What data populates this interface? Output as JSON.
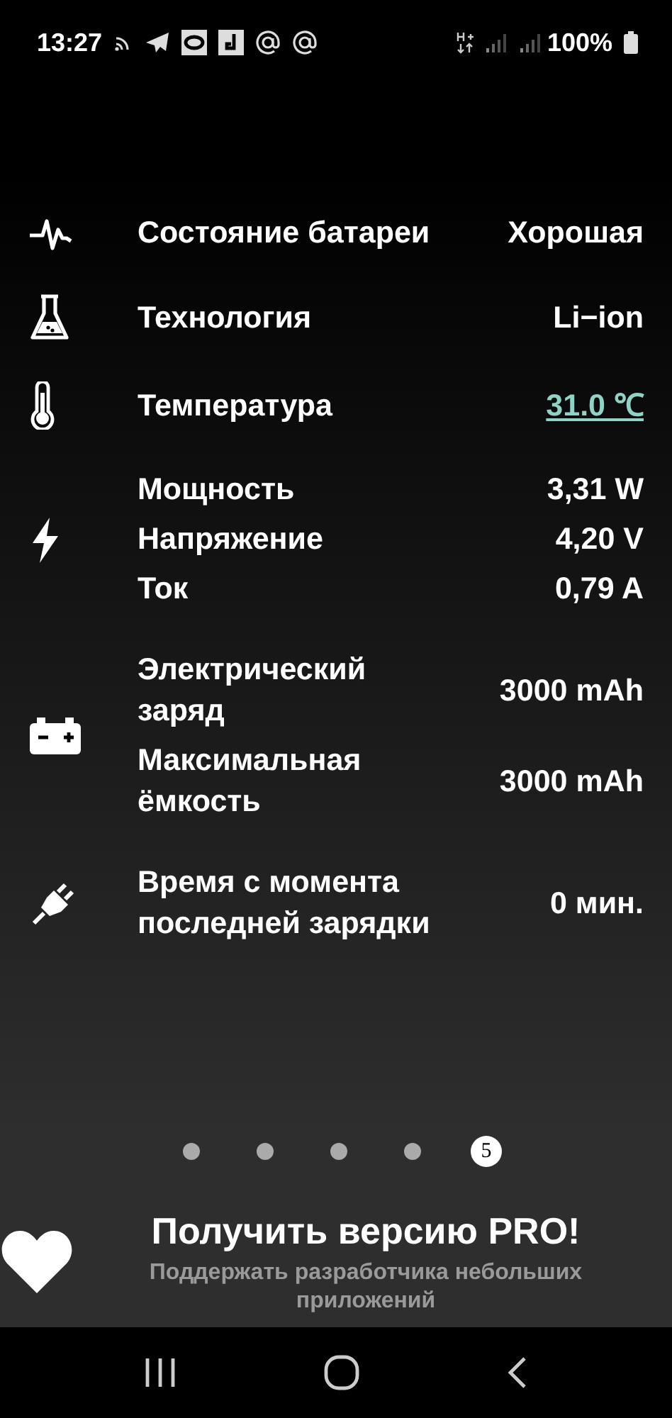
{
  "status_bar": {
    "time": "13:27",
    "battery": "100%"
  },
  "groups": [
    {
      "kind": "health",
      "rows": [
        {
          "label": "Состояние батареи",
          "value": "Хорошая",
          "link": false
        }
      ]
    },
    {
      "kind": "technology",
      "rows": [
        {
          "label": "Технология",
          "value": "Li−ion",
          "link": false
        }
      ]
    },
    {
      "kind": "temperature",
      "rows": [
        {
          "label": "Температура",
          "value": "31.0 ℃",
          "link": true
        }
      ]
    },
    {
      "kind": "power",
      "rows": [
        {
          "label": "Мощность",
          "value": "3,31 W",
          "link": false
        },
        {
          "label": "Напряжение",
          "value": "4,20 V",
          "link": false
        },
        {
          "label": "Ток",
          "value": "0,79 A",
          "link": false
        }
      ]
    },
    {
      "kind": "capacity",
      "rows": [
        {
          "label": "Электрический заряд",
          "value": "3000 mAh",
          "link": false
        },
        {
          "label": "Максимальная ёмкость",
          "value": "3000 mAh",
          "link": false
        }
      ]
    },
    {
      "kind": "charging",
      "rows": [
        {
          "label": "Время с момента последней зарядки",
          "value": "0 мин.",
          "link": false
        }
      ]
    }
  ],
  "pager": [
    {
      "selected": false
    },
    {
      "selected": false
    },
    {
      "selected": false
    },
    {
      "selected": false
    },
    {
      "selected": true,
      "label": "5"
    }
  ],
  "promo": {
    "title": "Получить версию PRO!",
    "subtitle": "Поддержать разработчика небольших приложений"
  }
}
